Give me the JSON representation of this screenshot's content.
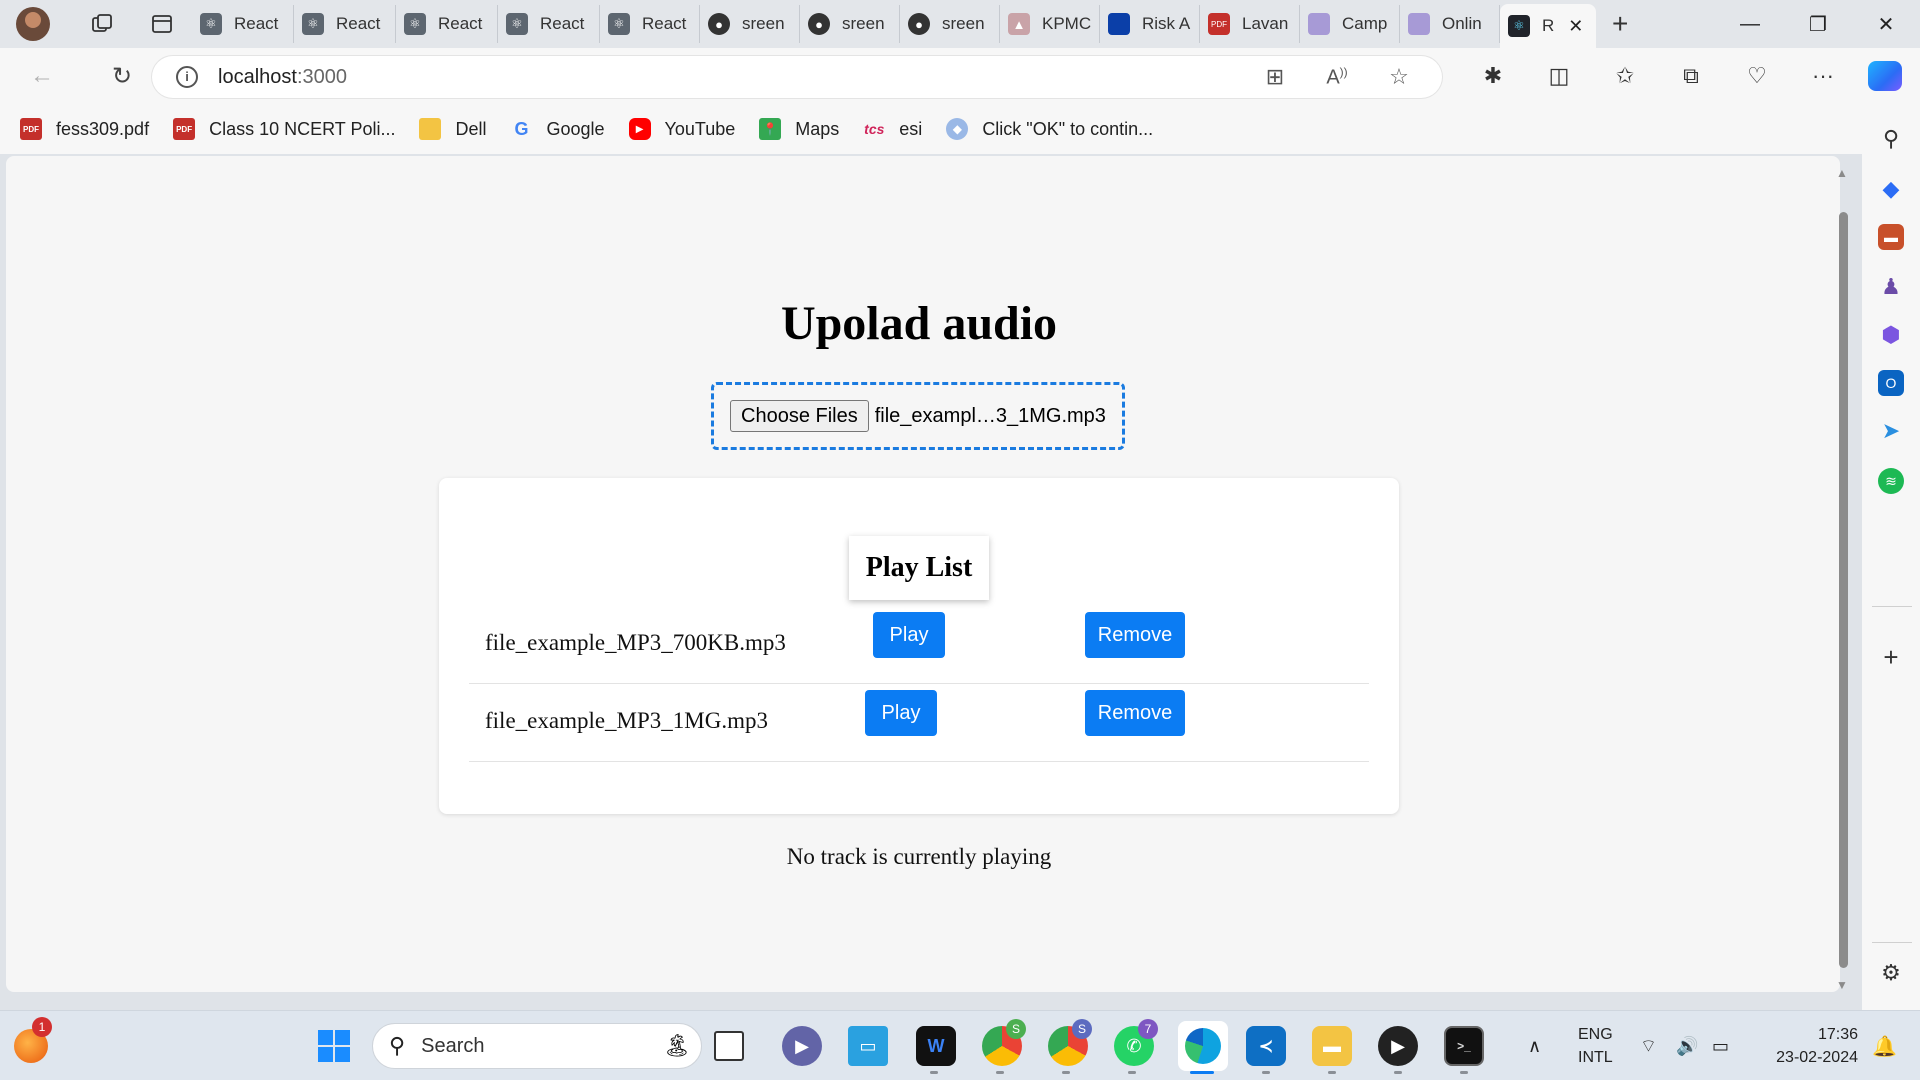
{
  "browser": {
    "tabs": [
      {
        "label": "React",
        "icon": "react-icon"
      },
      {
        "label": "React",
        "icon": "react-icon"
      },
      {
        "label": "React",
        "icon": "react-icon"
      },
      {
        "label": "React",
        "icon": "react-icon"
      },
      {
        "label": "React",
        "icon": "react-icon"
      },
      {
        "label": "sreen",
        "icon": "github-icon"
      },
      {
        "label": "sreen",
        "icon": "github-icon"
      },
      {
        "label": "sreen",
        "icon": "github-icon"
      },
      {
        "label": "KPMC",
        "icon": "kpmg-icon"
      },
      {
        "label": "Risk A",
        "icon": "doc-icon"
      },
      {
        "label": "Lavan",
        "icon": "pdf-icon"
      },
      {
        "label": "Camp",
        "icon": "page-icon"
      },
      {
        "label": "Onlin",
        "icon": "page-icon"
      }
    ],
    "active_tab": {
      "label": "R",
      "icon": "react-icon"
    },
    "address": {
      "host": "localhost",
      "port": ":3000"
    },
    "bookmarks": [
      {
        "label": "fess309.pdf",
        "icon": "pdf-icon"
      },
      {
        "label": "Class 10 NCERT Poli...",
        "icon": "pdf-icon"
      },
      {
        "label": "Dell",
        "icon": "folder-icon"
      },
      {
        "label": "Google",
        "icon": "google-icon"
      },
      {
        "label": "YouTube",
        "icon": "youtube-icon"
      },
      {
        "label": "Maps",
        "icon": "maps-icon"
      },
      {
        "label": "esi",
        "icon": "tcs-icon"
      },
      {
        "label": "Click \"OK\" to contin...",
        "icon": "web-icon"
      }
    ],
    "colors": {
      "accent": "#0b7cf3",
      "dropzone_border": "#1a7be0"
    }
  },
  "page": {
    "title": "Upolad audio",
    "file_input": {
      "button_label": "Choose Files",
      "selected_file": "file_exampl…3_1MG.mp3"
    },
    "playlist": {
      "heading": "Play List",
      "tracks": [
        {
          "name": "file_example_MP3_700KB.mp3",
          "play_label": "Play",
          "remove_label": "Remove"
        },
        {
          "name": "file_example_MP3_1MG.mp3",
          "play_label": "Play",
          "remove_label": "Remove"
        }
      ]
    },
    "status": "No track is currently playing"
  },
  "taskbar": {
    "search_placeholder": "Search",
    "notification_count": "1",
    "teams_badge": "S",
    "chrome_badge": "S",
    "whatsapp_badge": "7",
    "language": {
      "line1": "ENG",
      "line2": "INTL"
    },
    "clock": {
      "time": "17:36",
      "date": "23-02-2024"
    }
  }
}
